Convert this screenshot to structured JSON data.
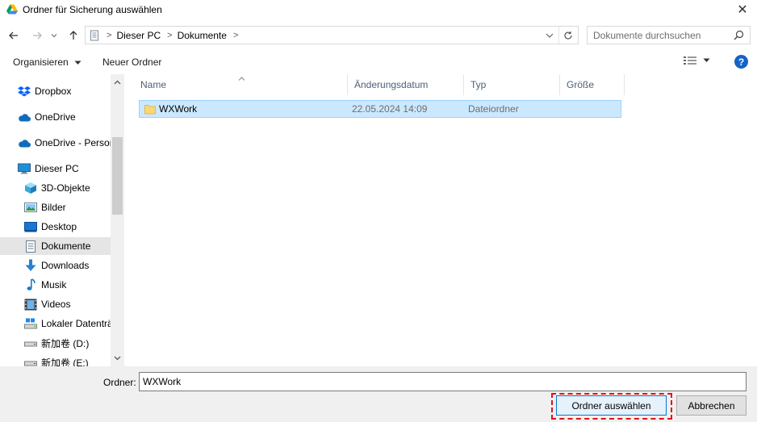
{
  "window": {
    "title": "Ordner für Sicherung auswählen",
    "close_glyph": "✕",
    "app_icon": "google-drive-icon"
  },
  "address": {
    "crumbs": [
      "Dieser PC",
      "Dokumente"
    ],
    "search_placeholder": "Dokumente durchsuchen"
  },
  "toolbar": {
    "organize_label": "Organisieren",
    "new_folder_label": "Neuer Ordner"
  },
  "sidebar": {
    "items": [
      {
        "label": "Dropbox",
        "icon": "dropbox-icon"
      },
      {
        "label": "OneDrive",
        "icon": "cloud-icon"
      },
      {
        "label": "OneDrive - Personal",
        "icon": "cloud-icon"
      },
      {
        "label": "Dieser PC",
        "icon": "computer-icon"
      },
      {
        "label": "3D-Objekte",
        "icon": "cube-icon"
      },
      {
        "label": "Bilder",
        "icon": "pictures-icon"
      },
      {
        "label": "Desktop",
        "icon": "desktop-icon"
      },
      {
        "label": "Dokumente",
        "icon": "documents-icon"
      },
      {
        "label": "Downloads",
        "icon": "download-icon"
      },
      {
        "label": "Musik",
        "icon": "music-icon"
      },
      {
        "label": "Videos",
        "icon": "video-icon"
      },
      {
        "label": "Lokaler Datenträger (C:)",
        "icon": "drive-icon"
      },
      {
        "label": "新加卷 (D:)",
        "icon": "drive-icon"
      },
      {
        "label": "新加卷 (E:)",
        "icon": "drive-icon"
      }
    ],
    "selected": "Dokumente"
  },
  "columns": [
    "Name",
    "Änderungsdatum",
    "Typ",
    "Größe"
  ],
  "files": [
    {
      "name": "WXWork",
      "modified": "22.05.2024 14:09",
      "type": "Dateiordner",
      "size": ""
    }
  ],
  "footer": {
    "folder_label": "Ordner:",
    "folder_value": "WXWork",
    "select_button": "Ordner auswählen",
    "cancel_button": "Abbrechen"
  },
  "colors": {
    "selection_bg": "#cce8ff",
    "highlight_dash": "#e0121a",
    "help_blue": "#1463c7"
  }
}
